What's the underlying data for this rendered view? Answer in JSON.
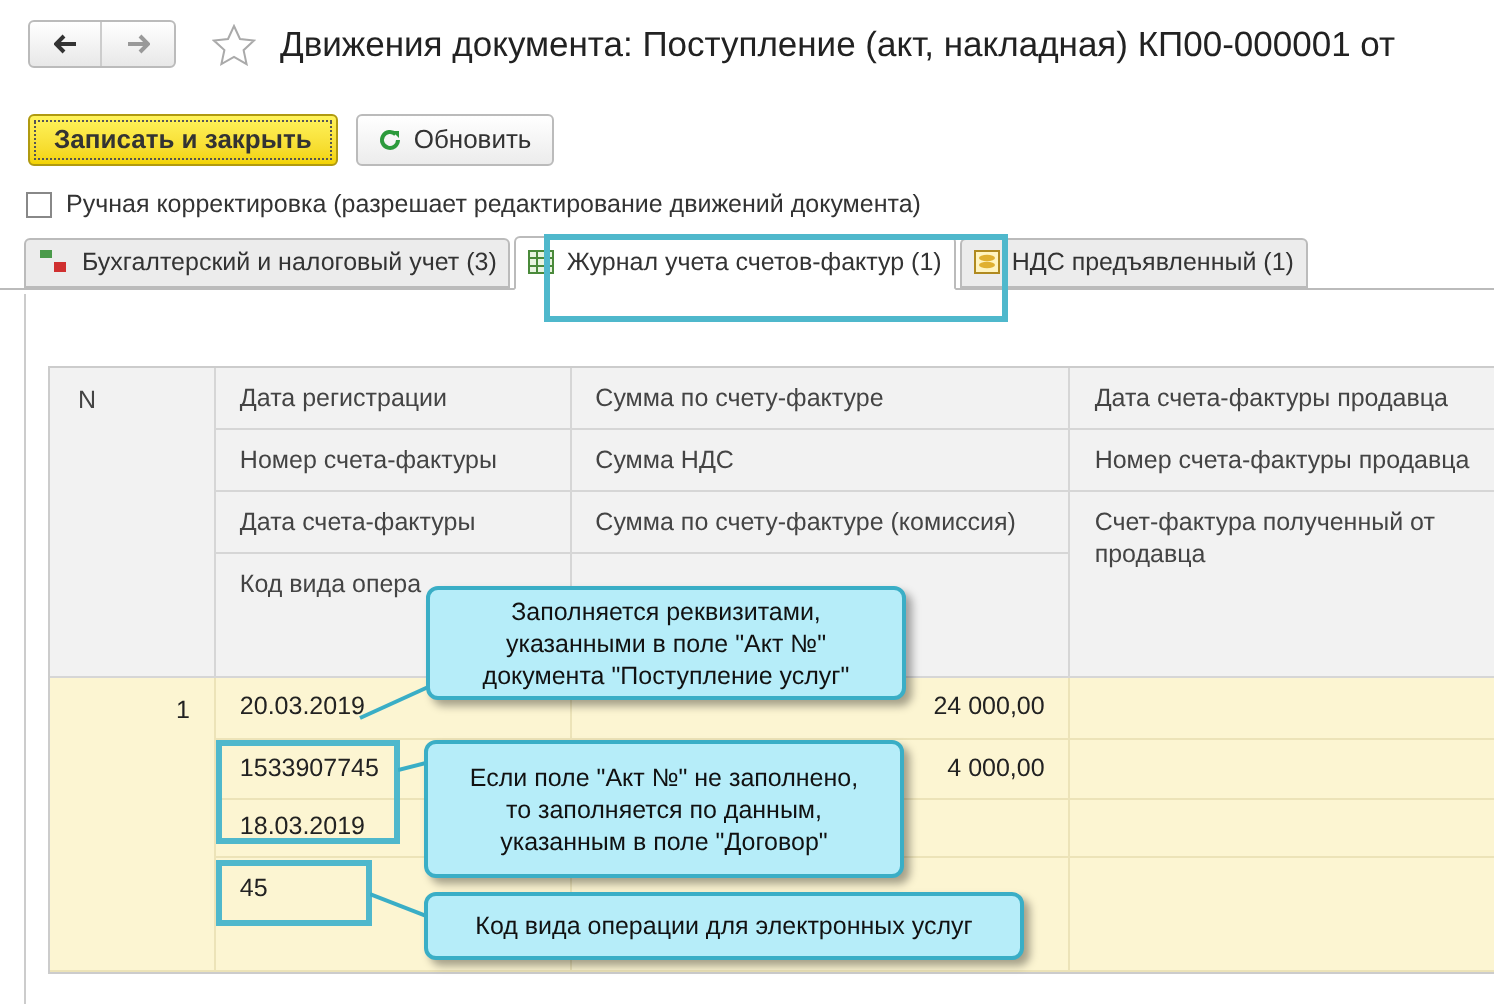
{
  "window": {
    "title": "Движения документа: Поступление (акт, накладная) КП00-000001 от"
  },
  "buttons": [
    {
      "label": "Записать и закрыть",
      "kind": "primary"
    },
    {
      "label": "Обновить",
      "kind": "refresh"
    }
  ],
  "checkbox": {
    "label": "Ручная корректировка (разрешает редактирование движений документа)",
    "checked": false
  },
  "tabs": [
    {
      "label": "Бухгалтерский и налоговый учет (3)",
      "kind": "dtkt",
      "selected": false
    },
    {
      "label": "Журнал учета счетов-фактур (1)",
      "kind": "table",
      "selected": true
    },
    {
      "label": "НДС предъявленный (1)",
      "kind": "coins",
      "selected": false
    }
  ],
  "table": {
    "columns": [
      {
        "lines": [
          "N"
        ]
      },
      {
        "lines": [
          "Дата регистрации",
          "Номер счета-фактуры",
          "Дата счета-фактуры",
          "Код вида опера"
        ]
      },
      {
        "lines": [
          "Сумма по счету-фактуре",
          "Сумма НДС",
          "Сумма по счету-фактуре (комиссия)"
        ]
      },
      {
        "lines": [
          "Дата счета-фактуры продавца",
          "Номер счета-фактуры продавца",
          "Счет-фактура полученный от продавца"
        ]
      }
    ],
    "rows": [
      {
        "n": "1",
        "column_2": [
          "20.03.2019",
          "1533907745",
          "18.03.2019",
          "45"
        ],
        "column_3": [
          "24 000,00",
          "4 000,00"
        ]
      }
    ]
  },
  "callouts": [
    "Заполняется реквизитами, указанными в поле \"Акт №\" документа \"Поступление услуг\"",
    "Если поле \"Акт №\" не заполнено, то заполняется по данным, указанным в поле \"Договор\"",
    "Код вида операции для электронных услуг"
  ]
}
